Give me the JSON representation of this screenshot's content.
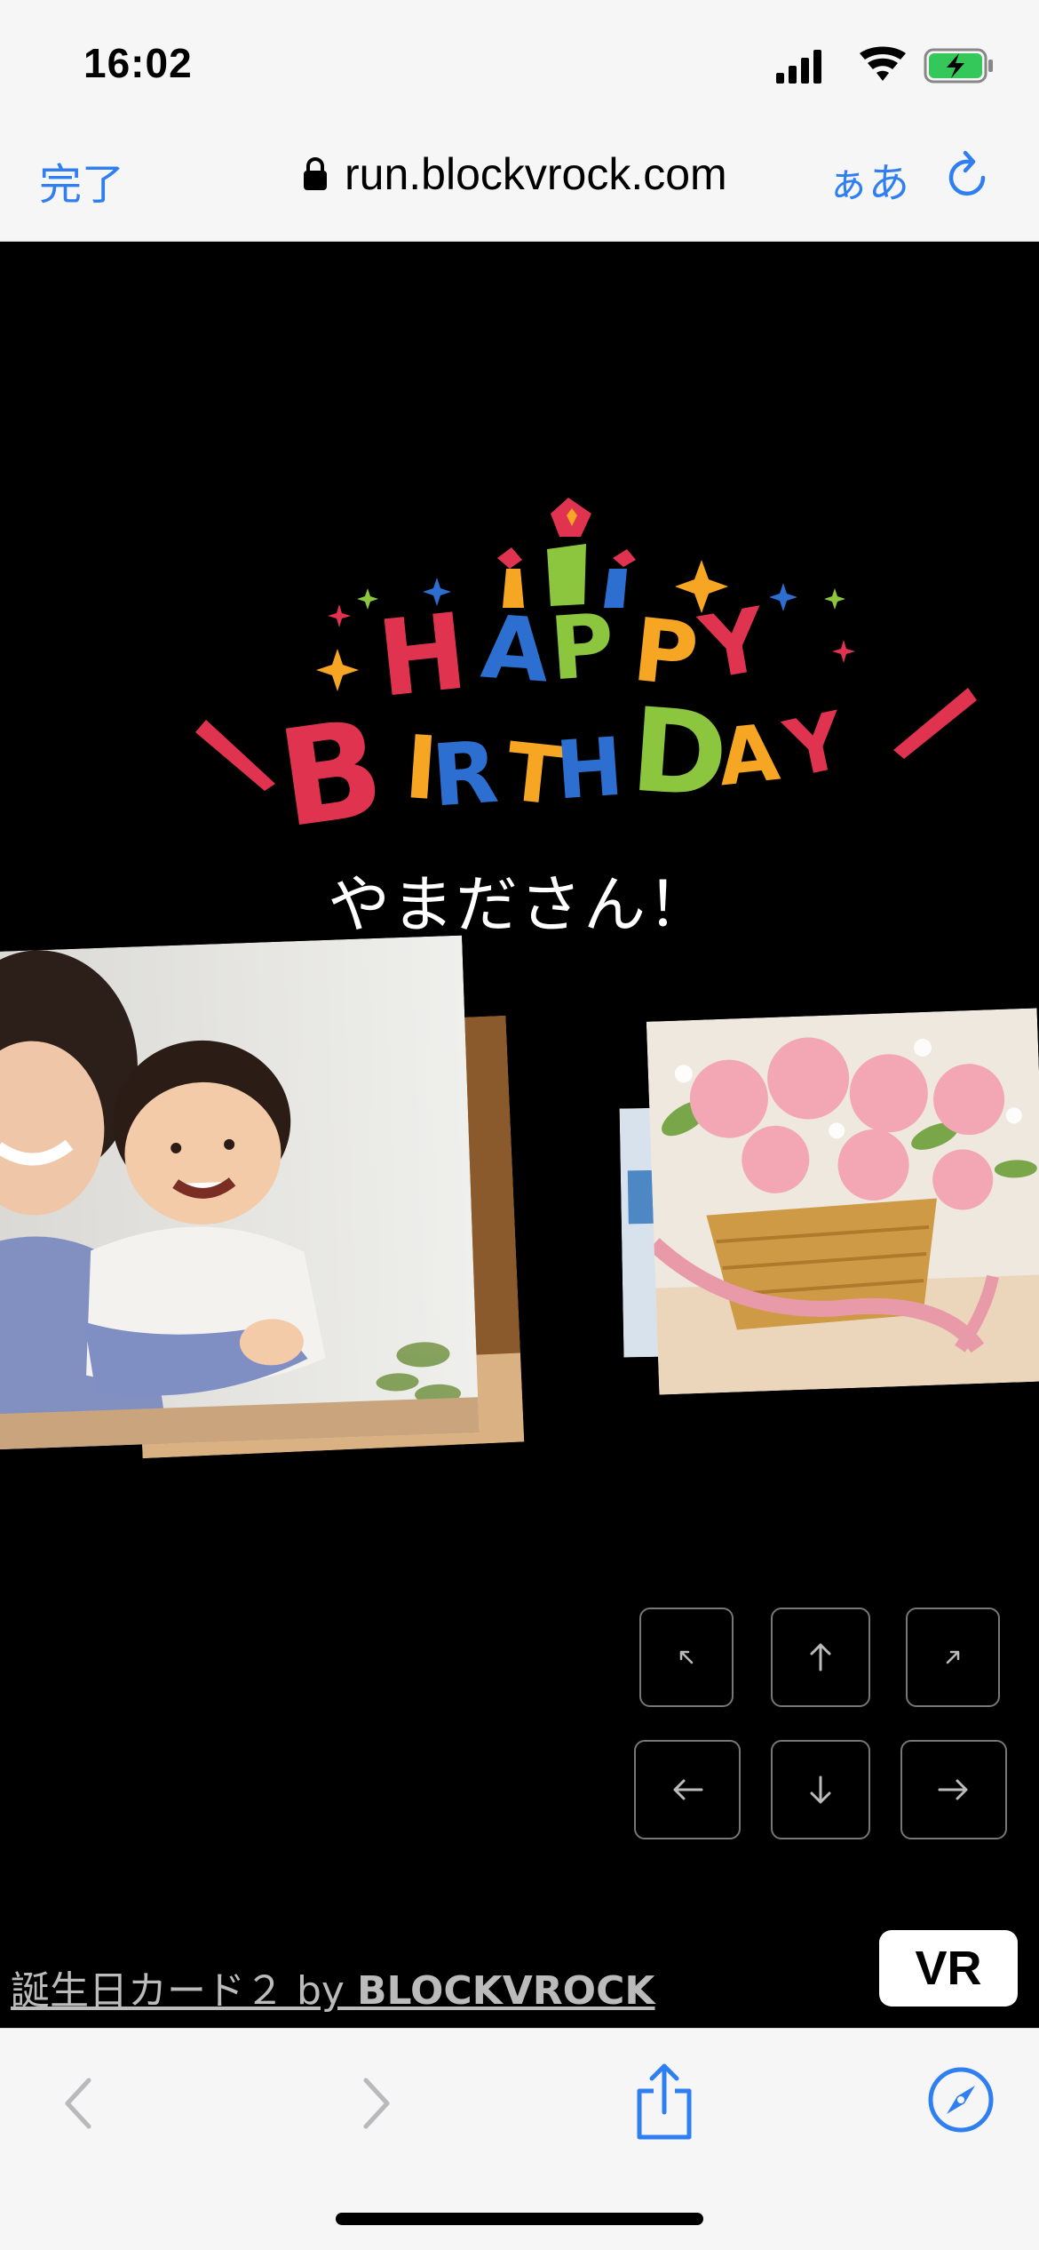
{
  "status_bar": {
    "time": "16:02",
    "icons": [
      "signal-icon",
      "wifi-icon",
      "battery-charging-icon"
    ],
    "battery_color": "#34c759"
  },
  "browser": {
    "done_label": "完了",
    "url": "run.blockvrock.com",
    "reader_label": "ぁあ",
    "accent_color": "#2f7ff3"
  },
  "content": {
    "logo_line1": "HAPPY",
    "logo_line2": "BIRTHDAY",
    "name_text": "やまださん！",
    "credit_prefix": "誕生日カード２ by ",
    "credit_brand": "BLOCKVROCK",
    "vr_label": "VR"
  },
  "nav_buttons": [
    "up-left-arrow-icon",
    "up-arrow-icon",
    "up-right-arrow-icon",
    "left-arrow-icon",
    "down-arrow-icon",
    "right-arrow-icon"
  ],
  "toolbar": [
    "back-icon",
    "forward-icon",
    "share-icon",
    "compass-icon"
  ]
}
